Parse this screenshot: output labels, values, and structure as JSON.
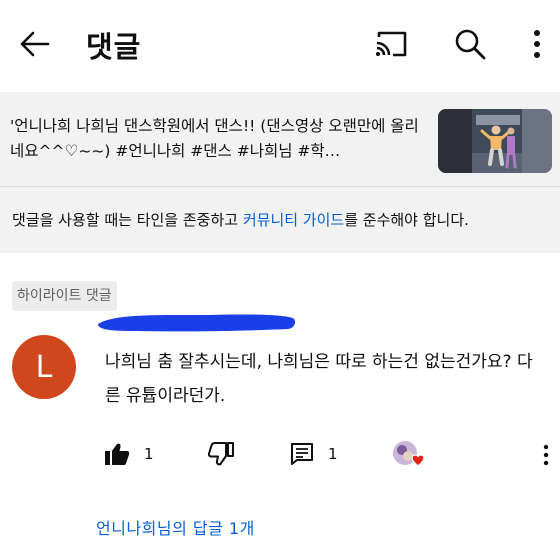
{
  "header": {
    "title": "댓글",
    "back_icon": "arrow-left-icon",
    "cast_icon": "cast-icon",
    "search_icon": "search-icon",
    "more_icon": "more-vertical-icon"
  },
  "video": {
    "title": "'언니나희 나희님 댄스학원에서 댄스!!  (댄스영상 오랜만에 올리네요^^♡~~)  #언니나희 #댄스 #나희님 #학…"
  },
  "guideline": {
    "prefix": "댓글을 사용할 때는 타인을 존중하고 ",
    "link": "커뮤니티 가이드",
    "suffix": "를 준수해야 합니다."
  },
  "comment": {
    "badge": "하이라이트 댓글",
    "avatar_letter": "L",
    "avatar_color": "#d0471d",
    "text": "나희님 춤 잘추시는데, 나희님은 따로 하는건 없는건가요? 다른 유튭이라던가.",
    "like_count": "1",
    "reply_count": "1",
    "replies_link": "언니나희님의 답글 1개"
  },
  "colors": {
    "link": "#065fd4",
    "redaction": "#1a3fe6",
    "heart": "#e62117"
  }
}
